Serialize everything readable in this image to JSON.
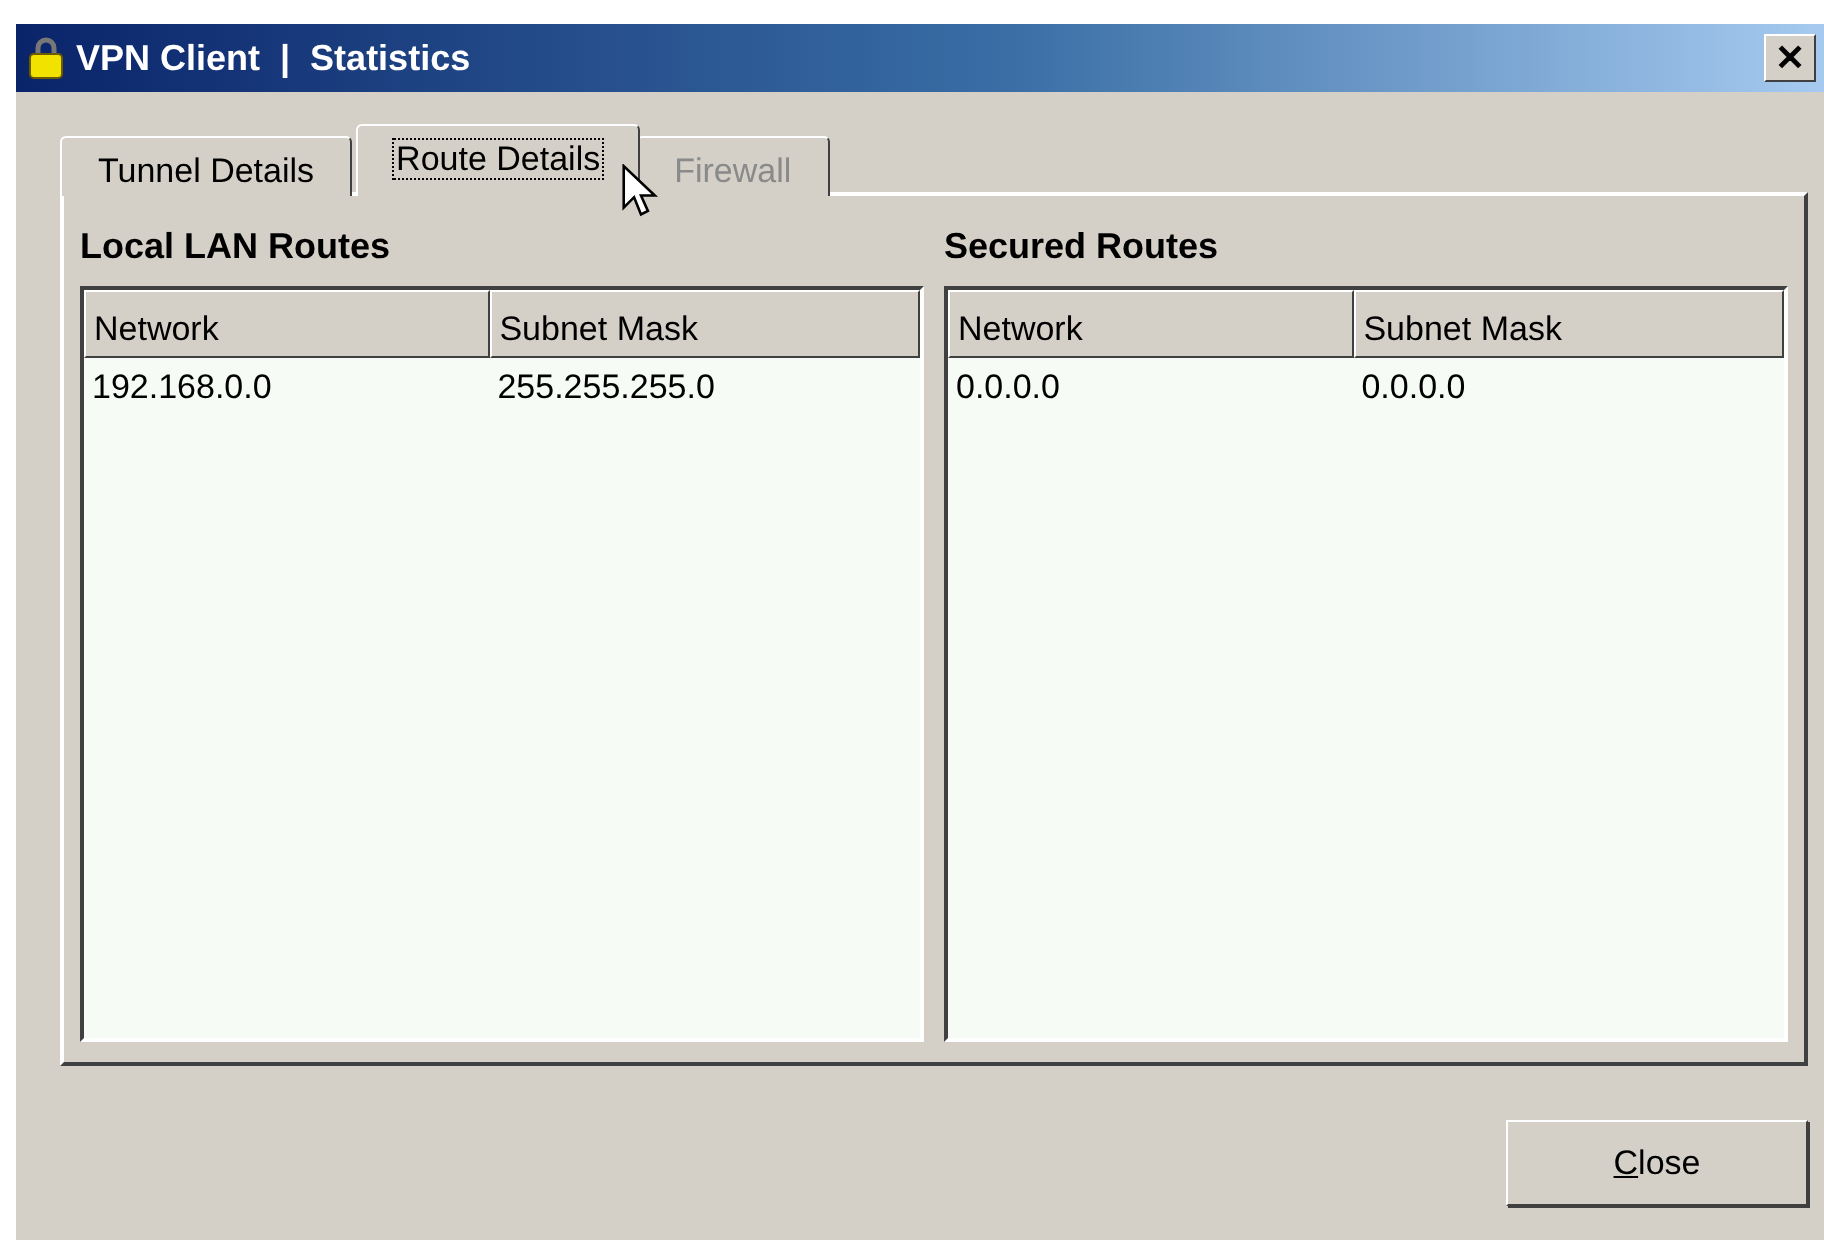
{
  "window": {
    "title": "VPN Client  |  Statistics",
    "close_glyph": "✕"
  },
  "tabs": [
    {
      "label": "Tunnel Details",
      "selected": false,
      "disabled": false
    },
    {
      "label": "Route Details",
      "selected": true,
      "disabled": false
    },
    {
      "label": "Firewall",
      "selected": false,
      "disabled": true
    }
  ],
  "panels": [
    {
      "heading": "Local LAN Routes",
      "columns": [
        "Network",
        "Subnet Mask"
      ],
      "rows": [
        [
          "192.168.0.0",
          "255.255.255.0"
        ]
      ]
    },
    {
      "heading": "Secured Routes",
      "columns": [
        "Network",
        "Subnet Mask"
      ],
      "rows": [
        [
          "0.0.0.0",
          "0.0.0.0"
        ]
      ]
    }
  ],
  "buttons": [
    {
      "label_parts": [
        {
          "text": "C",
          "underlined": true
        },
        {
          "text": "lose",
          "underlined": false
        }
      ]
    }
  ]
}
